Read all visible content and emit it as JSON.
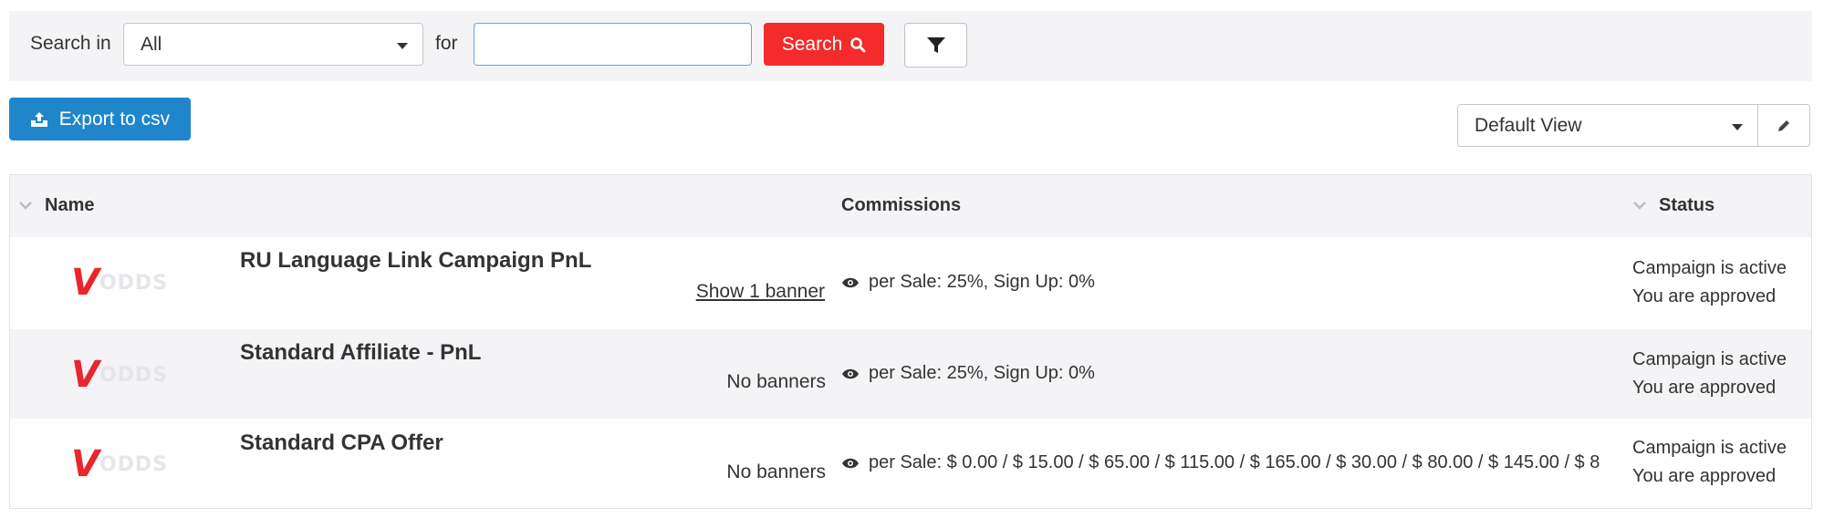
{
  "search": {
    "search_in_label": "Search in",
    "scope_value": "All",
    "for_label": "for",
    "query_value": "",
    "query_placeholder": "",
    "search_button_label": "Search"
  },
  "toolbar": {
    "export_label": "Export to csv",
    "view_value": "Default View"
  },
  "table": {
    "headers": {
      "name": "Name",
      "commissions": "Commissions",
      "status": "Status"
    },
    "rows": [
      {
        "logo_mark": "V",
        "logo_text": "ODDS",
        "name": "RU Language Link Campaign PnL",
        "banners": "Show 1 banner",
        "commission": "per Sale: 25%, Sign Up: 0%",
        "status_line1": "Campaign is active",
        "status_line2": "You are approved"
      },
      {
        "logo_mark": "V",
        "logo_text": "ODDS",
        "name": "Standard Affiliate - PnL",
        "banners": "No banners",
        "commission": "per Sale: 25%, Sign Up: 0%",
        "status_line1": "Campaign is active",
        "status_line2": "You are approved"
      },
      {
        "logo_mark": "V",
        "logo_text": "ODDS",
        "name": "Standard CPA Offer",
        "banners": "No banners",
        "commission": "per Sale: $ 0.00 / $ 15.00 / $ 65.00 / $ 115.00 / $ 165.00 / $ 30.00 / $ 80.00 / $ 145.00 / $ 8",
        "status_line1": "Campaign is active",
        "status_line2": "You are approved"
      }
    ]
  },
  "colors": {
    "search_button": "#f32b2b",
    "export_button": "#1f86cc",
    "input_focus_border": "#6aa4e0",
    "logo_red": "#e8262b"
  },
  "icons": {
    "search": "magnifier-icon",
    "filter": "funnel-icon",
    "export": "upload-icon",
    "edit": "pencil-icon",
    "sort": "chevron-down-icon",
    "commission_view": "eye-icon"
  }
}
